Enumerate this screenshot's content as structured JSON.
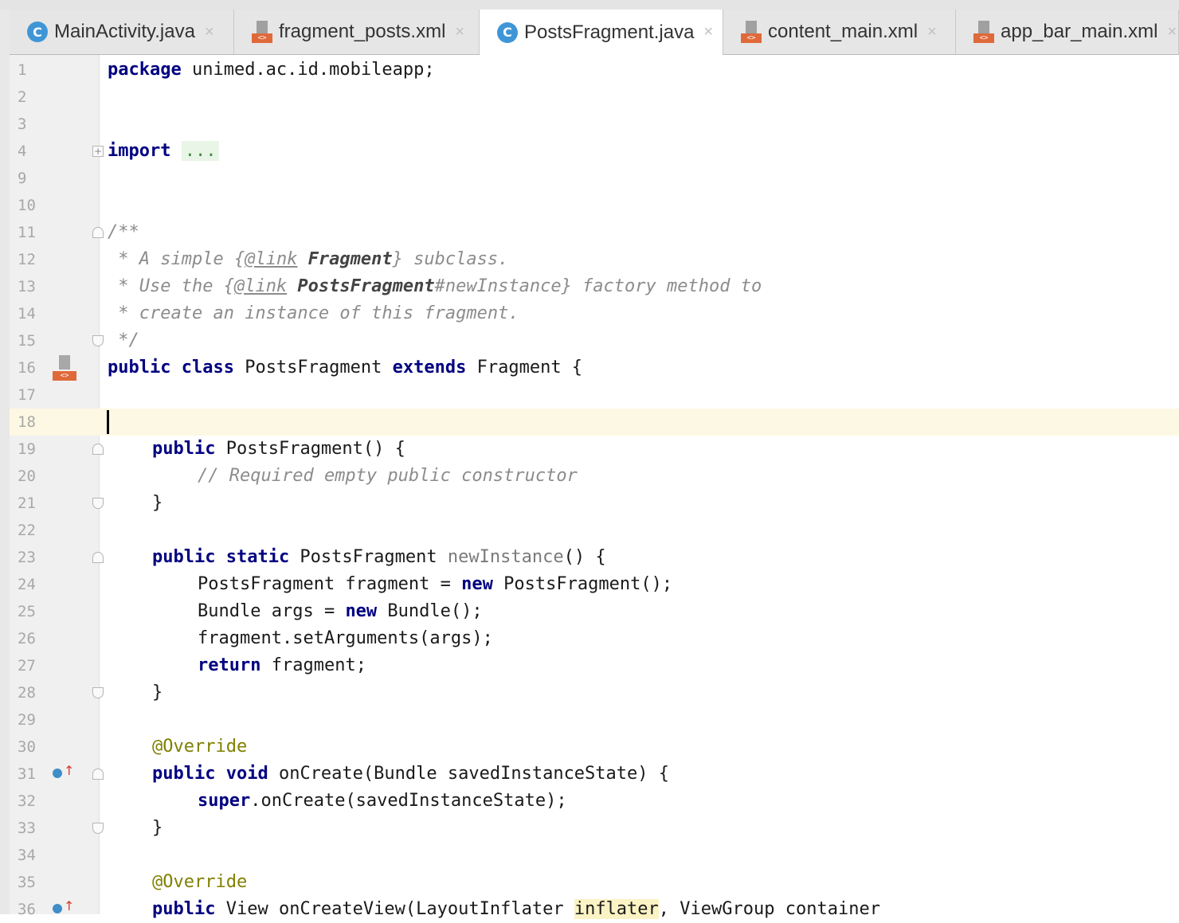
{
  "tabs": [
    {
      "label": "MainActivity.java",
      "icon": "java-class-icon",
      "active": false
    },
    {
      "label": "fragment_posts.xml",
      "icon": "xml-layout-icon",
      "active": false
    },
    {
      "label": "PostsFragment.java",
      "icon": "java-class-icon",
      "active": true
    },
    {
      "label": "content_main.xml",
      "icon": "xml-layout-icon",
      "active": false
    },
    {
      "label": "app_bar_main.xml",
      "icon": "xml-layout-icon",
      "active": false
    }
  ],
  "tab_close_glyph": "×",
  "java_icon_letter": "C",
  "xml_icon_badge": "<>",
  "editor": {
    "current_line": 18,
    "line_numbers": [
      "1",
      "2",
      "3",
      "4",
      "9",
      "10",
      "11",
      "12",
      "13",
      "14",
      "15",
      "16",
      "17",
      "18",
      "19",
      "20",
      "21",
      "22",
      "23",
      "24",
      "25",
      "26",
      "27",
      "28",
      "29",
      "30",
      "31",
      "32",
      "33",
      "34",
      "35",
      "36"
    ],
    "code": {
      "l1_kw": "package",
      "l1_rest": " unimed.ac.id.mobileapp;",
      "l4_kw": "import",
      "l4_dots": "...",
      "l11": "/**",
      "l12_a": " * A simple ",
      "l12_tag_open": "{",
      "l12_tag": "@link",
      "l12_b": " Fragment",
      "l12_c": "}",
      "l12_d": " subclass.",
      "l13_a": " * Use the ",
      "l13_tag_open": "{",
      "l13_tag": "@link",
      "l13_b": " PostsFragment",
      "l13_c": "#newInstance}",
      "l13_d": " factory method to",
      "l14": " * create an instance of this fragment.",
      "l15": " */",
      "l16_kw1": "public class",
      "l16_a": " PostsFragment ",
      "l16_kw2": "extends",
      "l16_b": " Fragment {",
      "l19_kw": "public",
      "l19_rest": " PostsFragment() {",
      "l20": "// Required empty public constructor",
      "l21": "}",
      "l23_kw": "public static",
      "l23_a": " PostsFragment ",
      "l23_fn": "newInstance",
      "l23_b": "() {",
      "l24_a": "PostsFragment fragment = ",
      "l24_kw": "new",
      "l24_b": " PostsFragment();",
      "l25_a": "Bundle args = ",
      "l25_kw": "new",
      "l25_b": " Bundle();",
      "l26": "fragment.setArguments(args);",
      "l27_kw": "return",
      "l27_rest": " fragment;",
      "l28": "}",
      "l30": "@Override",
      "l31_kw": "public void",
      "l31_rest": " onCreate(Bundle savedInstanceState) {",
      "l32_kw": "super",
      "l32_rest": ".onCreate(savedInstanceState);",
      "l33": "}",
      "l35": "@Override",
      "l36_kw": "public",
      "l36_a": " View onCreateView(LayoutInflater ",
      "l36_hl": "inflater",
      "l36_b": ", ViewGroup container"
    }
  },
  "fold_expand_glyph": "+",
  "override_arrow_glyph": "↑"
}
